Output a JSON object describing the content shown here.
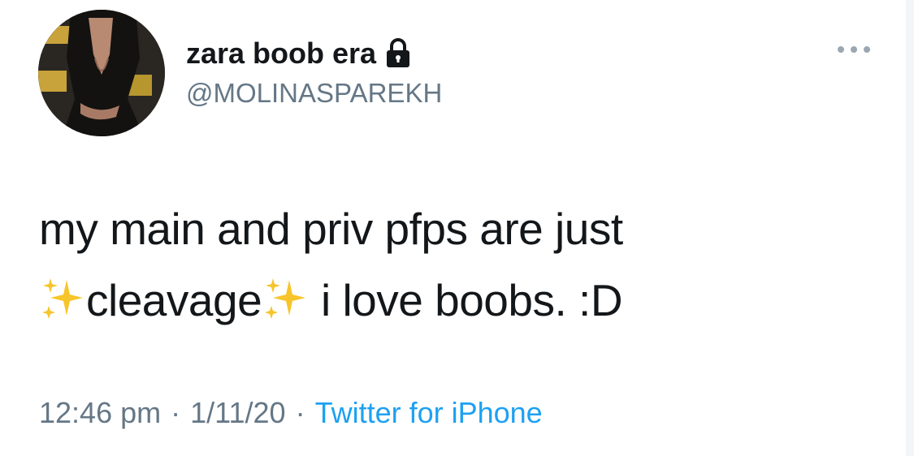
{
  "user": {
    "display_name": "zara boob era",
    "handle": "@MOLINASPAREKH",
    "protected_icon": "lock-icon",
    "avatar_icon": "profile-photo"
  },
  "tweet": {
    "line1": "my main and priv pfps are just",
    "line2_word": "cleavage",
    "line2_rest": " i love boobs. :D",
    "emoji": "sparkles-icon"
  },
  "meta": {
    "time": "12:46 pm",
    "separator": "·",
    "date": "1/11/20",
    "source": "Twitter for iPhone"
  },
  "menu_icon": "more-options-icon",
  "colors": {
    "text": "#14171a",
    "secondary": "#657786",
    "link": "#1da1f2"
  }
}
